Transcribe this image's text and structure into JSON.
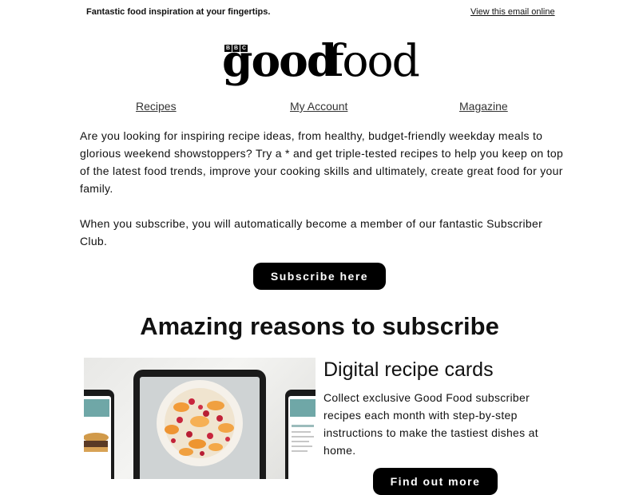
{
  "header": {
    "tagline": "Fantastic food inspiration at your fingertips.",
    "view_online": "View this email online"
  },
  "logo": {
    "bbc": [
      "B",
      "B",
      "C"
    ],
    "good": "good",
    "food": "food"
  },
  "nav": {
    "items": [
      {
        "label": "Recipes"
      },
      {
        "label": "My Account"
      },
      {
        "label": "Magazine"
      }
    ]
  },
  "intro": {
    "paragraph1": "Are you looking for inspiring recipe ideas, from healthy, budget-friendly weekday meals to glorious weekend showstoppers? Try a * and get triple-tested recipes to help you keep on top of the latest food trends, improve your cooking skills and ultimately, create great food for your family.",
    "paragraph2": "When you subscribe, you will automatically become a member of our fantastic Subscriber Club."
  },
  "subscribe_button": "Subscribe here",
  "section": {
    "heading": "Amazing reasons to subscribe"
  },
  "card": {
    "title": "Digital recipe cards",
    "text": "Collect exclusive Good Food subscriber recipes each month with step-by-step instructions to make the tastiest dishes at home.",
    "button": "Find out more"
  }
}
